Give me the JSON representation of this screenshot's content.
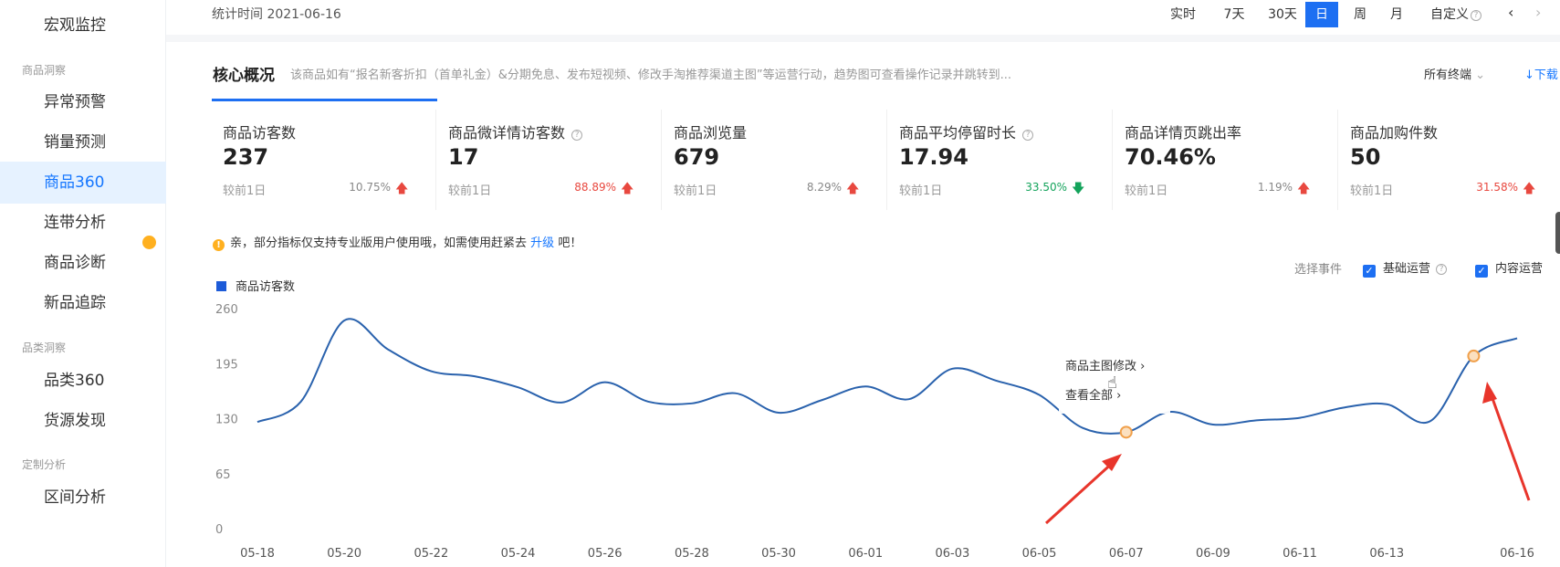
{
  "sidebar": {
    "items": [
      {
        "label": "宏观监控"
      },
      {
        "label": "异常预警"
      },
      {
        "label": "销量预测"
      },
      {
        "label": "商品360"
      },
      {
        "label": "连带分析"
      },
      {
        "label": "商品诊断"
      },
      {
        "label": "新品追踪"
      },
      {
        "label": "品类360"
      },
      {
        "label": "货源发现"
      },
      {
        "label": "区间分析"
      }
    ],
    "sections": [
      "商品洞察",
      "品类洞察",
      "定制分析"
    ]
  },
  "topbar": {
    "stat_time": "统计时间 2021-06-16",
    "ranges": [
      "实时",
      "7天",
      "30天",
      "日",
      "周",
      "月",
      "自定义"
    ],
    "active_range": "日",
    "prev": "‹",
    "next": "›"
  },
  "core": {
    "title": "核心概况",
    "desc": "该商品如有“报名新客折扣（首单礼金）&分期免息、发布短视频、修改手淘推荐渠道主图”等运营行动，趋势图可查看操作记录并跳转到...",
    "terminal": "所有终端",
    "download": "↓下载"
  },
  "metrics": [
    {
      "label": "商品访客数",
      "value": "237",
      "cmp": "较前1日",
      "pct": "10.75%",
      "dir": "up",
      "help": false
    },
    {
      "label": "商品微详情访客数",
      "value": "17",
      "cmp": "较前1日",
      "pct": "88.89%",
      "dir": "up",
      "help": true
    },
    {
      "label": "商品浏览量",
      "value": "679",
      "cmp": "较前1日",
      "pct": "8.29%",
      "dir": "up",
      "help": false
    },
    {
      "label": "商品平均停留时长",
      "value": "17.94",
      "cmp": "较前1日",
      "pct": "33.50%",
      "dir": "down",
      "help": true
    },
    {
      "label": "商品详情页跳出率",
      "value": "70.46%",
      "cmp": "较前1日",
      "pct": "1.19%",
      "dir": "up",
      "help": false
    },
    {
      "label": "商品加购件数",
      "value": "50",
      "cmp": "较前1日",
      "pct": "31.58%",
      "dir": "up",
      "help": false
    }
  ],
  "colors": {
    "accent": "#1d6ff2",
    "up": "#e8483f",
    "down": "#13a35b",
    "line": "#2a62ad",
    "marker": "#f0a04b",
    "arrow": "#e8352b"
  },
  "notice": {
    "text": "亲，部分指标仅支持专业版用户使用哦，如需使用赶紧去",
    "link": "升级",
    "tail": "吧！"
  },
  "chart_header": {
    "legend": "商品访客数",
    "events_label": "选择事件",
    "checks": [
      "基础运营",
      "内容运营"
    ]
  },
  "popup": {
    "item1": "商品主图修改 ›",
    "item2": "查看全部 ›"
  },
  "chart_data": {
    "type": "line",
    "x_labels": [
      "05-18",
      "05-20",
      "05-22",
      "05-24",
      "05-26",
      "05-28",
      "05-30",
      "06-01",
      "06-03",
      "06-05",
      "06-07",
      "06-09",
      "06-11",
      "06-13",
      "06-16"
    ],
    "y_ticks": [
      0,
      65,
      130,
      195,
      260
    ],
    "ylim": [
      0,
      260
    ],
    "series": [
      {
        "name": "商品访客数",
        "x": [
          "05-18",
          "05-19",
          "05-20",
          "05-21",
          "05-22",
          "05-23",
          "05-24",
          "05-25",
          "05-26",
          "05-27",
          "05-28",
          "05-29",
          "05-30",
          "05-31",
          "06-01",
          "06-02",
          "06-03",
          "06-04",
          "06-05",
          "06-06",
          "06-07",
          "06-08",
          "06-09",
          "06-10",
          "06-11",
          "06-12",
          "06-13",
          "06-14",
          "06-15",
          "06-16"
        ],
        "values": [
          126,
          150,
          246,
          212,
          186,
          180,
          167,
          149,
          173,
          150,
          148,
          160,
          137,
          152,
          168,
          153,
          189,
          175,
          158,
          119,
          114,
          138,
          123,
          128,
          131,
          143,
          147,
          127,
          204,
          225
        ]
      }
    ],
    "markers": [
      "06-07",
      "06-15"
    ],
    "gap": [
      "06-07",
      "06-09"
    ]
  }
}
